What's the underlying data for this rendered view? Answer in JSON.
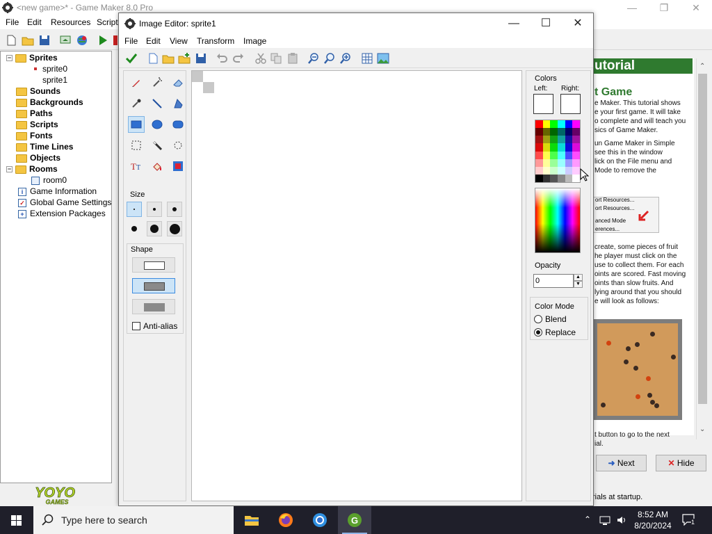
{
  "gm": {
    "title": "<new game>* - Game Maker 8.0 Pro",
    "menus": [
      "File",
      "Edit",
      "Resources",
      "Script"
    ],
    "tree": [
      {
        "label": "Sprites",
        "bold": true,
        "expander": "−"
      },
      {
        "label": "sprite0",
        "bold": false,
        "child": true
      },
      {
        "label": "sprite1",
        "bold": false,
        "child": true
      },
      {
        "label": "Sounds",
        "bold": true
      },
      {
        "label": "Backgrounds",
        "bold": true
      },
      {
        "label": "Paths",
        "bold": true
      },
      {
        "label": "Scripts",
        "bold": true
      },
      {
        "label": "Fonts",
        "bold": true
      },
      {
        "label": "Time Lines",
        "bold": true
      },
      {
        "label": "Objects",
        "bold": true
      },
      {
        "label": "Rooms",
        "bold": true,
        "expander": "−"
      },
      {
        "label": "room0",
        "bold": false,
        "child": true
      },
      {
        "label": "Game Information",
        "bold": false
      },
      {
        "label": "Global Game Settings",
        "bold": false
      },
      {
        "label": "Extension Packages",
        "bold": false
      }
    ],
    "logo_text": "YOYO",
    "logo_sub": "GAMES"
  },
  "tutorial": {
    "title": "utorial",
    "heading": "t Game",
    "lines": [
      "e Maker. This tutorial shows",
      "e your first game. It will take",
      "o complete and will teach you",
      "sics of Game Maker.",
      "",
      "un Game Maker in Simple",
      "see this in the window",
      "lick on the File menu and",
      "Mode to remove the"
    ],
    "shot_lines": [
      "ort Resources...",
      "ort Resources...",
      "anced Mode",
      "erences..."
    ],
    "lines2": [
      "create, some pieces of fruit",
      "he player must click on the",
      "use to collect them. For each",
      "oints are scored. Fast moving",
      "oints than slow fruits. And",
      "lying around that you should",
      "e will look as follows:"
    ],
    "lines3": [
      "t button to go to the next",
      "ial."
    ],
    "next_label": "Next",
    "hide_label": "Hide",
    "footer": "rials at startup."
  },
  "editor": {
    "title": "Image Editor: sprite1",
    "menus": [
      "File",
      "Edit",
      "View",
      "Transform",
      "Image"
    ],
    "size_label": "Size",
    "shape_label": "Shape",
    "antialias_label": "Anti-alias",
    "antialias_checked": false,
    "colors_label": "Colors",
    "left_label": "Left:",
    "right_label": "Right:",
    "left_color": "#ffffff",
    "right_color": "#ffffff",
    "opacity_label": "Opacity",
    "opacity_value": "0",
    "color_mode_label": "Color Mode",
    "blend_label": "Blend",
    "replace_label": "Replace",
    "color_mode_selected": "Replace"
  },
  "taskbar": {
    "search_placeholder": "Type here to search",
    "time": "8:52 AM",
    "date": "8/20/2024",
    "notification_count": "1"
  }
}
